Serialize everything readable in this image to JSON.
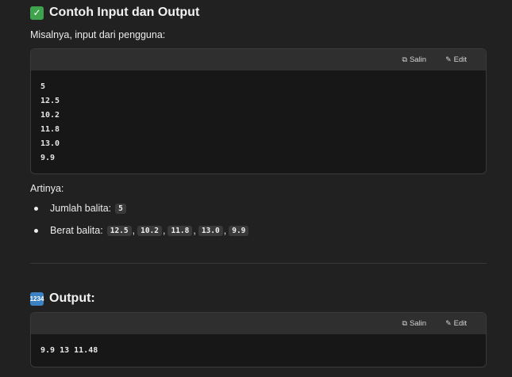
{
  "section1": {
    "title": "Contoh Input dan Output",
    "emoji": "✓",
    "intro": "Misalnya, input dari pengguna:",
    "code_toolbar": {
      "copy_label": "Salin",
      "edit_label": "Edit"
    },
    "code_lines": [
      "5",
      "12.5",
      "10.2",
      "11.8",
      "13.0",
      "9.9"
    ],
    "meaning": "Artinya:",
    "bullets": {
      "jumlah_label": "Jumlah balita:",
      "jumlah_value": "5",
      "berat_label": "Berat balita:",
      "berat_values": [
        "12.5",
        "10.2",
        "11.8",
        "13.0",
        "9.9"
      ],
      "separator": ","
    }
  },
  "section2": {
    "title": "Output:",
    "emoji": "1234",
    "code_toolbar": {
      "copy_label": "Salin",
      "edit_label": "Edit"
    },
    "code_lines": [
      "9.9 13 11.48"
    ]
  }
}
